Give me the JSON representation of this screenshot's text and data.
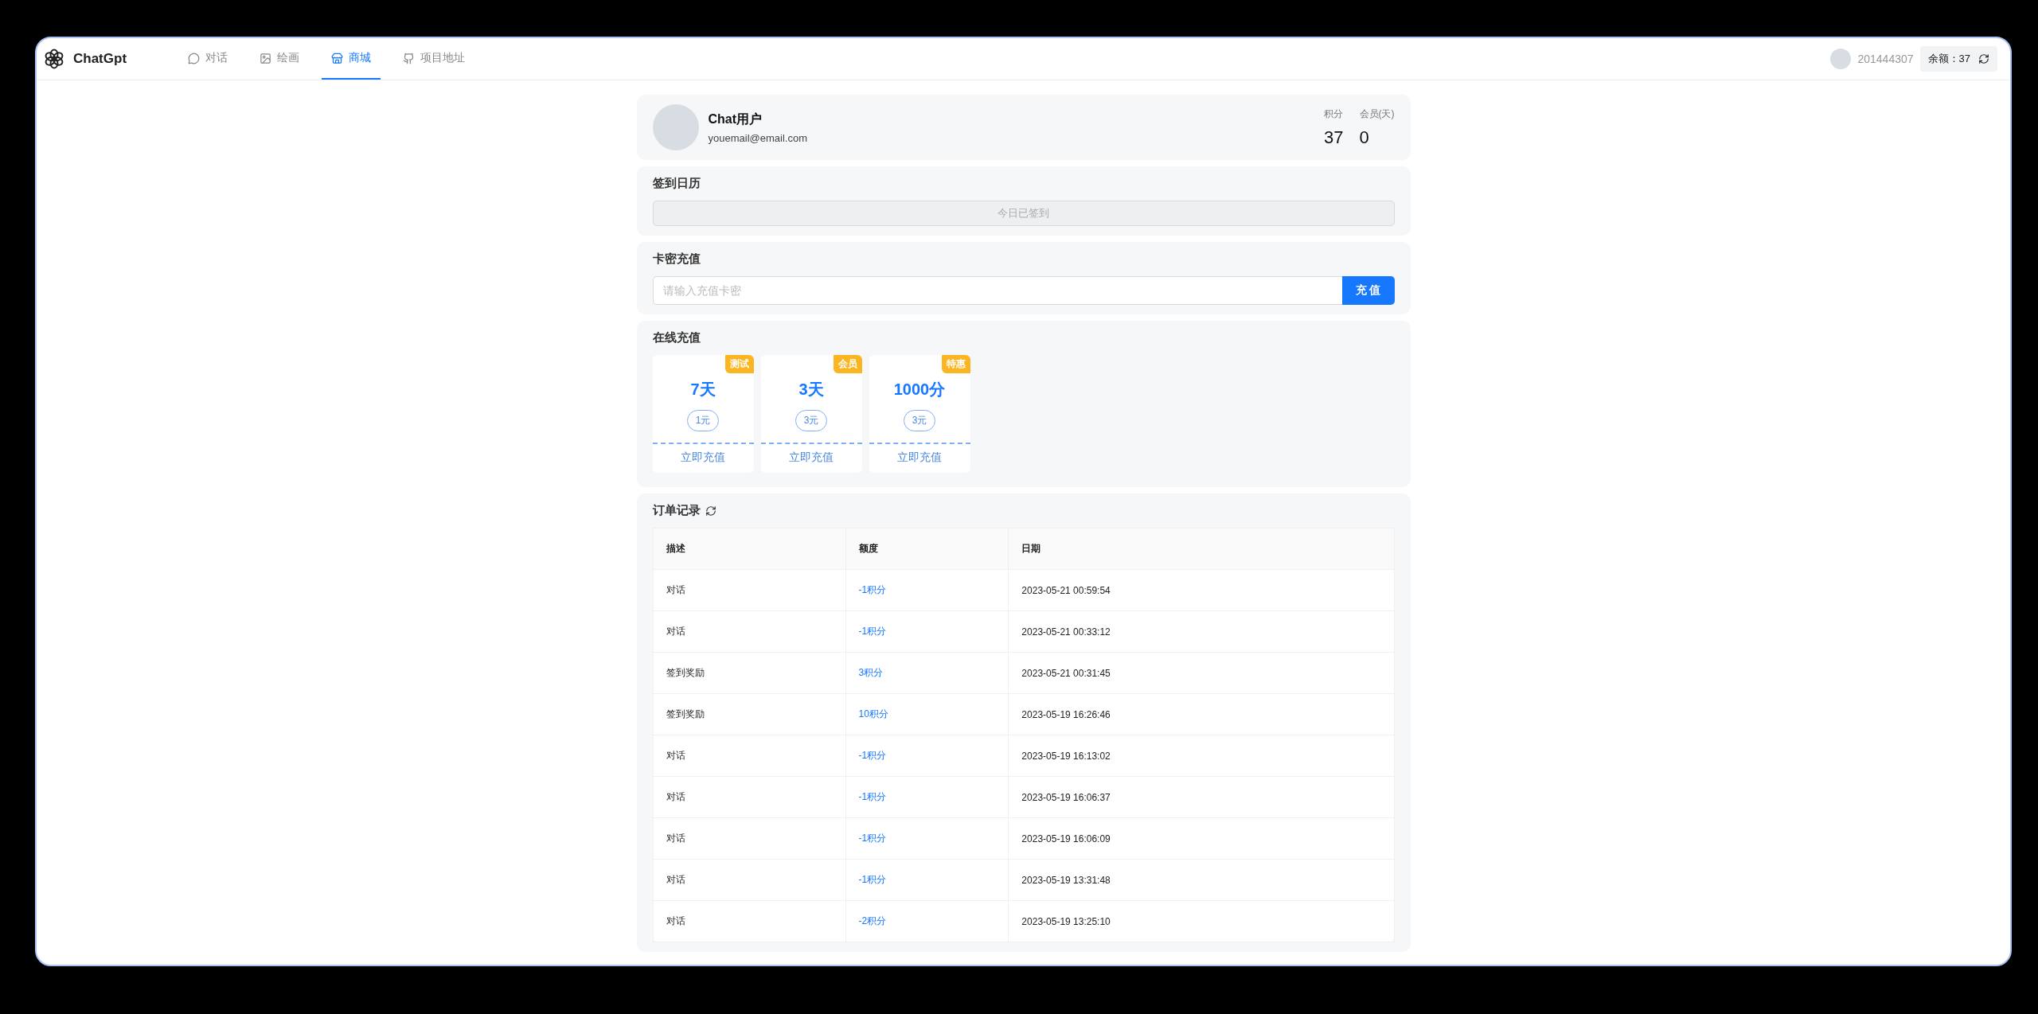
{
  "app": {
    "name": "ChatGpt"
  },
  "nav": [
    {
      "label": "对话",
      "selected": false
    },
    {
      "label": "绘画",
      "selected": false
    },
    {
      "label": "商城",
      "selected": true
    },
    {
      "label": "项目地址",
      "selected": false
    }
  ],
  "user": {
    "id": "201444307",
    "balance": "余额：37"
  },
  "profile": {
    "name": "Chat用户",
    "email": "youemail@email.com",
    "stats": [
      {
        "label": "积分",
        "value": "37"
      },
      {
        "label": "会员(天)",
        "value": "0"
      }
    ]
  },
  "checkin": {
    "title": "签到日历",
    "button": "今日已签到",
    "disabled": true
  },
  "card_recharge": {
    "title": "卡密充值",
    "placeholder": "请输入充值卡密",
    "button": "充 值"
  },
  "online": {
    "title": "在线充值",
    "packages": [
      {
        "tag": "测试",
        "amount": "7天",
        "price": "1元",
        "action": "立即充值"
      },
      {
        "tag": "会员",
        "amount": "3天",
        "price": "3元",
        "action": "立即充值"
      },
      {
        "tag": "特惠",
        "amount": "1000分",
        "price": "3元",
        "action": "立即充值"
      }
    ]
  },
  "orders": {
    "title": "订单记录",
    "columns": [
      "描述",
      "额度",
      "日期"
    ],
    "rows": [
      [
        "对话",
        "-1积分",
        "2023-05-21 00:59:54"
      ],
      [
        "对话",
        "-1积分",
        "2023-05-21 00:33:12"
      ],
      [
        "签到奖励",
        "3积分",
        "2023-05-21 00:31:45"
      ],
      [
        "签到奖励",
        "10积分",
        "2023-05-19 16:26:46"
      ],
      [
        "对话",
        "-1积分",
        "2023-05-19 16:13:02"
      ],
      [
        "对话",
        "-1积分",
        "2023-05-19 16:06:37"
      ],
      [
        "对话",
        "-1积分",
        "2023-05-19 16:06:09"
      ],
      [
        "对话",
        "-1积分",
        "2023-05-19 13:31:48"
      ],
      [
        "对话",
        "-2积分",
        "2023-05-19 13:25:10"
      ]
    ]
  }
}
